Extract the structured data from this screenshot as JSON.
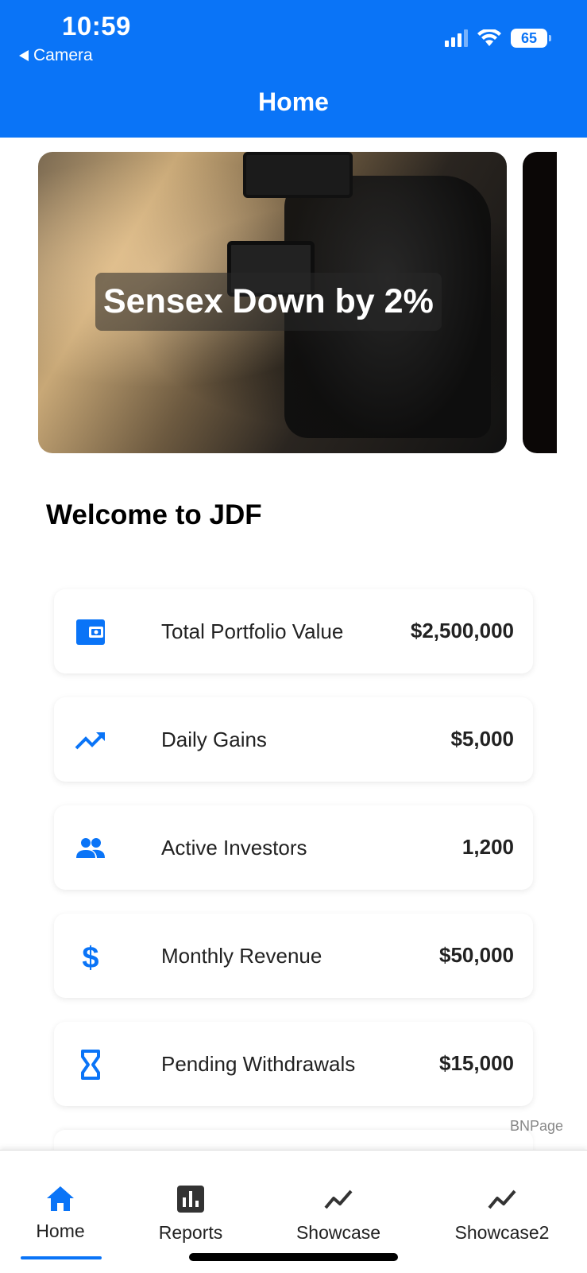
{
  "status_bar": {
    "time": "10:59",
    "back_label": "Camera",
    "battery": "65"
  },
  "header": {
    "title": "Home"
  },
  "carousel": {
    "slides": [
      {
        "headline": "Sensex Down by 2%"
      }
    ]
  },
  "welcome": "Welcome to JDF",
  "stats": [
    {
      "icon": "wallet-icon",
      "label": "Total Portfolio Value",
      "value": "$2,500,000"
    },
    {
      "icon": "trending-up-icon",
      "label": "Daily Gains",
      "value": "$5,000"
    },
    {
      "icon": "people-icon",
      "label": "Active Investors",
      "value": "1,200"
    },
    {
      "icon": "dollar-icon",
      "label": "Monthly Revenue",
      "value": "$50,000"
    },
    {
      "icon": "hourglass-icon",
      "label": "Pending Withdrawals",
      "value": "$15,000"
    }
  ],
  "footer_note": "BNPage",
  "tabbar": {
    "tabs": [
      {
        "label": "Home",
        "icon": "home-icon",
        "active": true
      },
      {
        "label": "Reports",
        "icon": "bar-chart-icon"
      },
      {
        "label": "Showcase",
        "icon": "line-chart-icon"
      },
      {
        "label": "Showcase2",
        "icon": "line-chart-icon"
      }
    ]
  },
  "colors": {
    "accent": "#0A74F7",
    "text": "#222222"
  }
}
